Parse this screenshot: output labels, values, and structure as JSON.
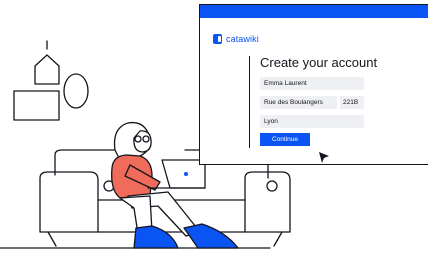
{
  "app": {
    "brand": "catawiki",
    "brand_color": "#0a54f4",
    "ink_color": "#14141e"
  },
  "signup": {
    "title": "Create your account",
    "fields": {
      "name": "Emma Laurent",
      "street": "Rue des Boulangers",
      "house_number": "221B",
      "city": "Lyon"
    },
    "continue_label": "Continue"
  },
  "icons": [
    "catawiki-logo-icon",
    "pointer-cursor-icon"
  ]
}
